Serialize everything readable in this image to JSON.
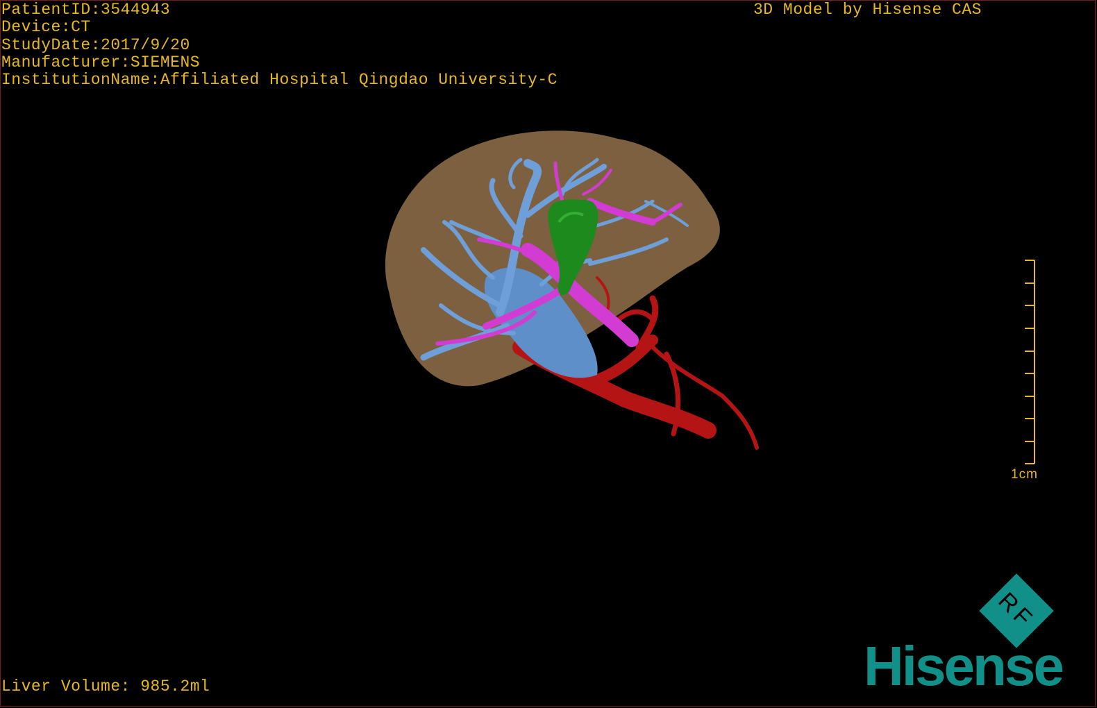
{
  "header": {
    "patient_id": "PatientID:3544943",
    "device": "Device:CT",
    "study_date": "StudyDate:2017/9/20",
    "manufacturer": "Manufacturer:SIEMENS",
    "institution": "InstitutionName:Affiliated Hospital Qingdao University-C"
  },
  "brand_label": "3D Model by Hisense CAS",
  "footer": {
    "liver_volume": "Liver Volume: 985.2ml"
  },
  "scale": {
    "label": "1cm",
    "ticks": 10
  },
  "logo": {
    "word": "Hisense",
    "badge": "RF"
  },
  "colors": {
    "text": "#e8b820",
    "liver": "#8a6a46",
    "hepatic_vein": "#6f9fd8",
    "portal_vein": "#d23cd2",
    "gallbladder": "#1c8a1c",
    "artery": "#b51414",
    "logo": "#109088"
  },
  "icons": [
    "liver-model",
    "scale-bar-icon",
    "rf-badge-icon"
  ]
}
